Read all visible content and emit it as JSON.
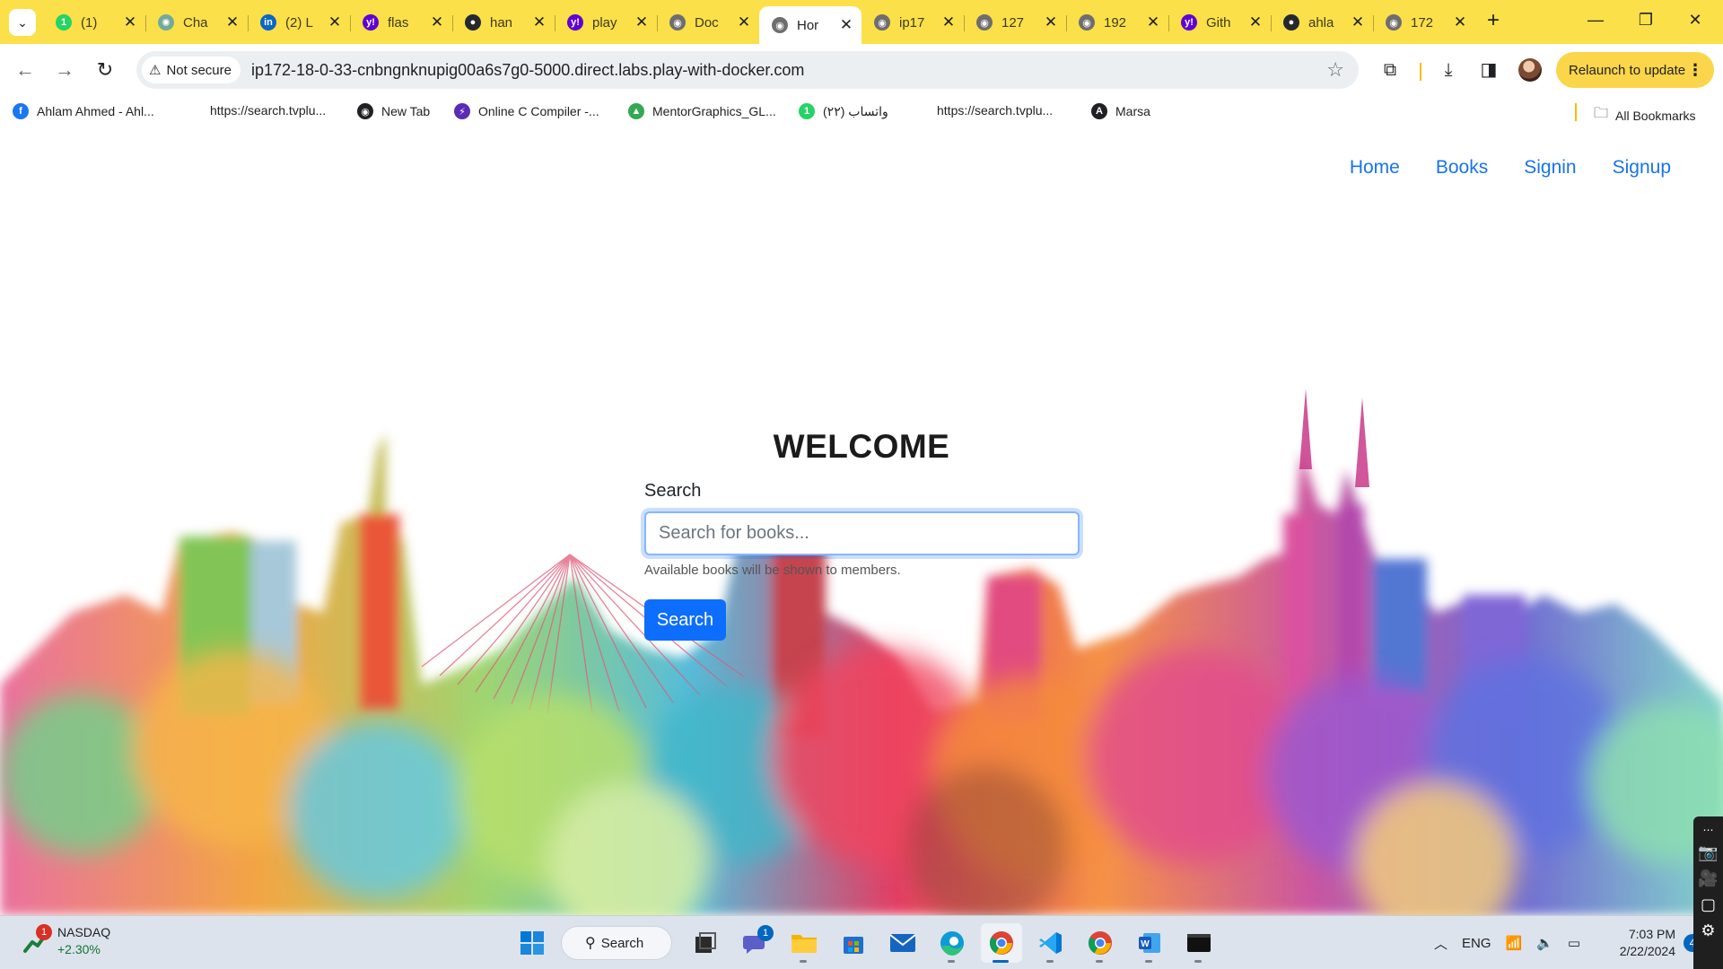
{
  "browser": {
    "tabs": [
      {
        "title": "(1)",
        "favicon": "whatsapp-icon",
        "color": "#25d366",
        "glyph": "1",
        "active": false
      },
      {
        "title": "Cha",
        "favicon": "chatgpt-icon",
        "color": "#74aa9c",
        "glyph": "✺",
        "active": false
      },
      {
        "title": "(2) L",
        "favicon": "linkedin-icon",
        "color": "#0a66c2",
        "glyph": "in",
        "active": false
      },
      {
        "title": "flas",
        "favicon": "yahoo-icon",
        "color": "#6001d2",
        "glyph": "y!",
        "active": false
      },
      {
        "title": "han",
        "favicon": "github-icon",
        "color": "#24292f",
        "glyph": "●",
        "active": false
      },
      {
        "title": "play",
        "favicon": "yahoo-icon",
        "color": "#6001d2",
        "glyph": "y!",
        "active": false
      },
      {
        "title": "Doc",
        "favicon": "globe-icon",
        "color": "#6e6e6e",
        "glyph": "◉",
        "active": false
      },
      {
        "title": "Hor",
        "favicon": "globe-icon",
        "color": "#6e6e6e",
        "glyph": "◉",
        "active": true
      },
      {
        "title": "ip17",
        "favicon": "globe-icon",
        "color": "#6e6e6e",
        "glyph": "◉",
        "active": false
      },
      {
        "title": "127",
        "favicon": "globe-icon",
        "color": "#6e6e6e",
        "glyph": "◉",
        "active": false
      },
      {
        "title": "192",
        "favicon": "globe-icon",
        "color": "#6e6e6e",
        "glyph": "◉",
        "active": false
      },
      {
        "title": "Gith",
        "favicon": "yahoo-icon",
        "color": "#6001d2",
        "glyph": "y!",
        "active": false
      },
      {
        "title": "ahla",
        "favicon": "github-icon",
        "color": "#24292f",
        "glyph": "●",
        "active": false
      },
      {
        "title": "172",
        "favicon": "globe-icon",
        "color": "#6e6e6e",
        "glyph": "◉",
        "active": false
      }
    ],
    "security_label": "Not secure",
    "url": "ip172-18-0-33-cnbngnknupig00a6s7g0-5000.direct.labs.play-with-docker.com",
    "relaunch_label": "Relaunch to update",
    "bookmarks": [
      {
        "label": "Ahlam Ahmed - Ahl...",
        "icon": "facebook-icon",
        "color": "#1877f2",
        "glyph": "f"
      },
      {
        "label": "https://search.tvplu...",
        "icon": "blank-icon",
        "color": "",
        "glyph": ""
      },
      {
        "label": "New Tab",
        "icon": "chrome-newtab-icon",
        "color": "#202124",
        "glyph": "◉"
      },
      {
        "label": "Online C Compiler -...",
        "icon": "compiler-icon",
        "color": "#5b2bb5",
        "glyph": "⚡"
      },
      {
        "label": "MentorGraphics_GL...",
        "icon": "google-drive-icon",
        "color": "#34a853",
        "glyph": "▲"
      },
      {
        "label": "واتساب (٢٢)",
        "icon": "whatsapp-icon",
        "color": "#25d366",
        "glyph": "1"
      },
      {
        "label": "https://search.tvplu...",
        "icon": "blank-icon",
        "color": "",
        "glyph": ""
      },
      {
        "label": "Marsa",
        "icon": "angular-icon",
        "color": "#202124",
        "glyph": "A"
      }
    ],
    "all_bookmarks_label": "All Bookmarks"
  },
  "site": {
    "nav": [
      "Home",
      "Books",
      "Signin",
      "Signup"
    ],
    "welcome": "WELCOME",
    "search_label": "Search",
    "search_placeholder": "Search for books...",
    "help_text": "Available books will be shown to members.",
    "search_button": "Search"
  },
  "taskbar": {
    "widget_name": "NASDAQ",
    "widget_change": "+2.30%",
    "widget_badge": "1",
    "search_label": "Search",
    "teams_badge": "1",
    "language": "ENG",
    "time": "7:03 PM",
    "date": "2/22/2024",
    "notification_count": "4"
  },
  "colors": {
    "tabstrip": "#fbe04a",
    "link": "#1a73e8",
    "primary_button": "#0d6efd"
  }
}
